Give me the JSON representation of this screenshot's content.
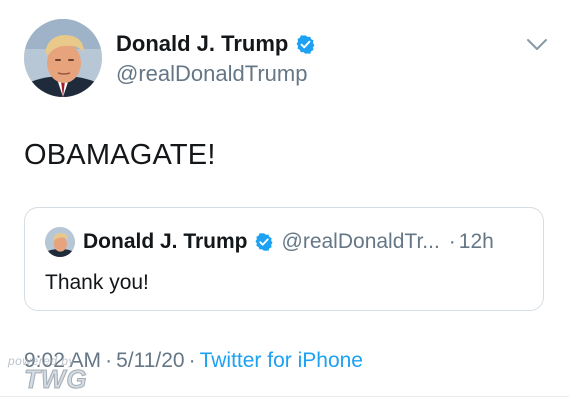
{
  "tweet": {
    "author": {
      "display_name": "Donald J. Trump",
      "handle": "@realDonaldTrump",
      "verified": true,
      "avatar_icon": "profile-photo"
    },
    "text": "OBAMAGATE!",
    "menu_icon": "chevron-down-icon",
    "quoted_tweet": {
      "display_name": "Donald J. Trump",
      "handle": "@realDonaldTr...",
      "dot": "·",
      "time": "12h",
      "text": "Thank you!"
    },
    "meta": {
      "time": "9:02 AM",
      "separator": "·",
      "date": "5/11/20",
      "source": "Twitter for iPhone"
    }
  },
  "watermark": {
    "line1": "powered by",
    "line2": "TWG"
  },
  "colors": {
    "text": "#14171a",
    "secondary": "#657786",
    "link": "#1da1f2",
    "border": "#d6dde3",
    "verified": "#1da1f2"
  }
}
